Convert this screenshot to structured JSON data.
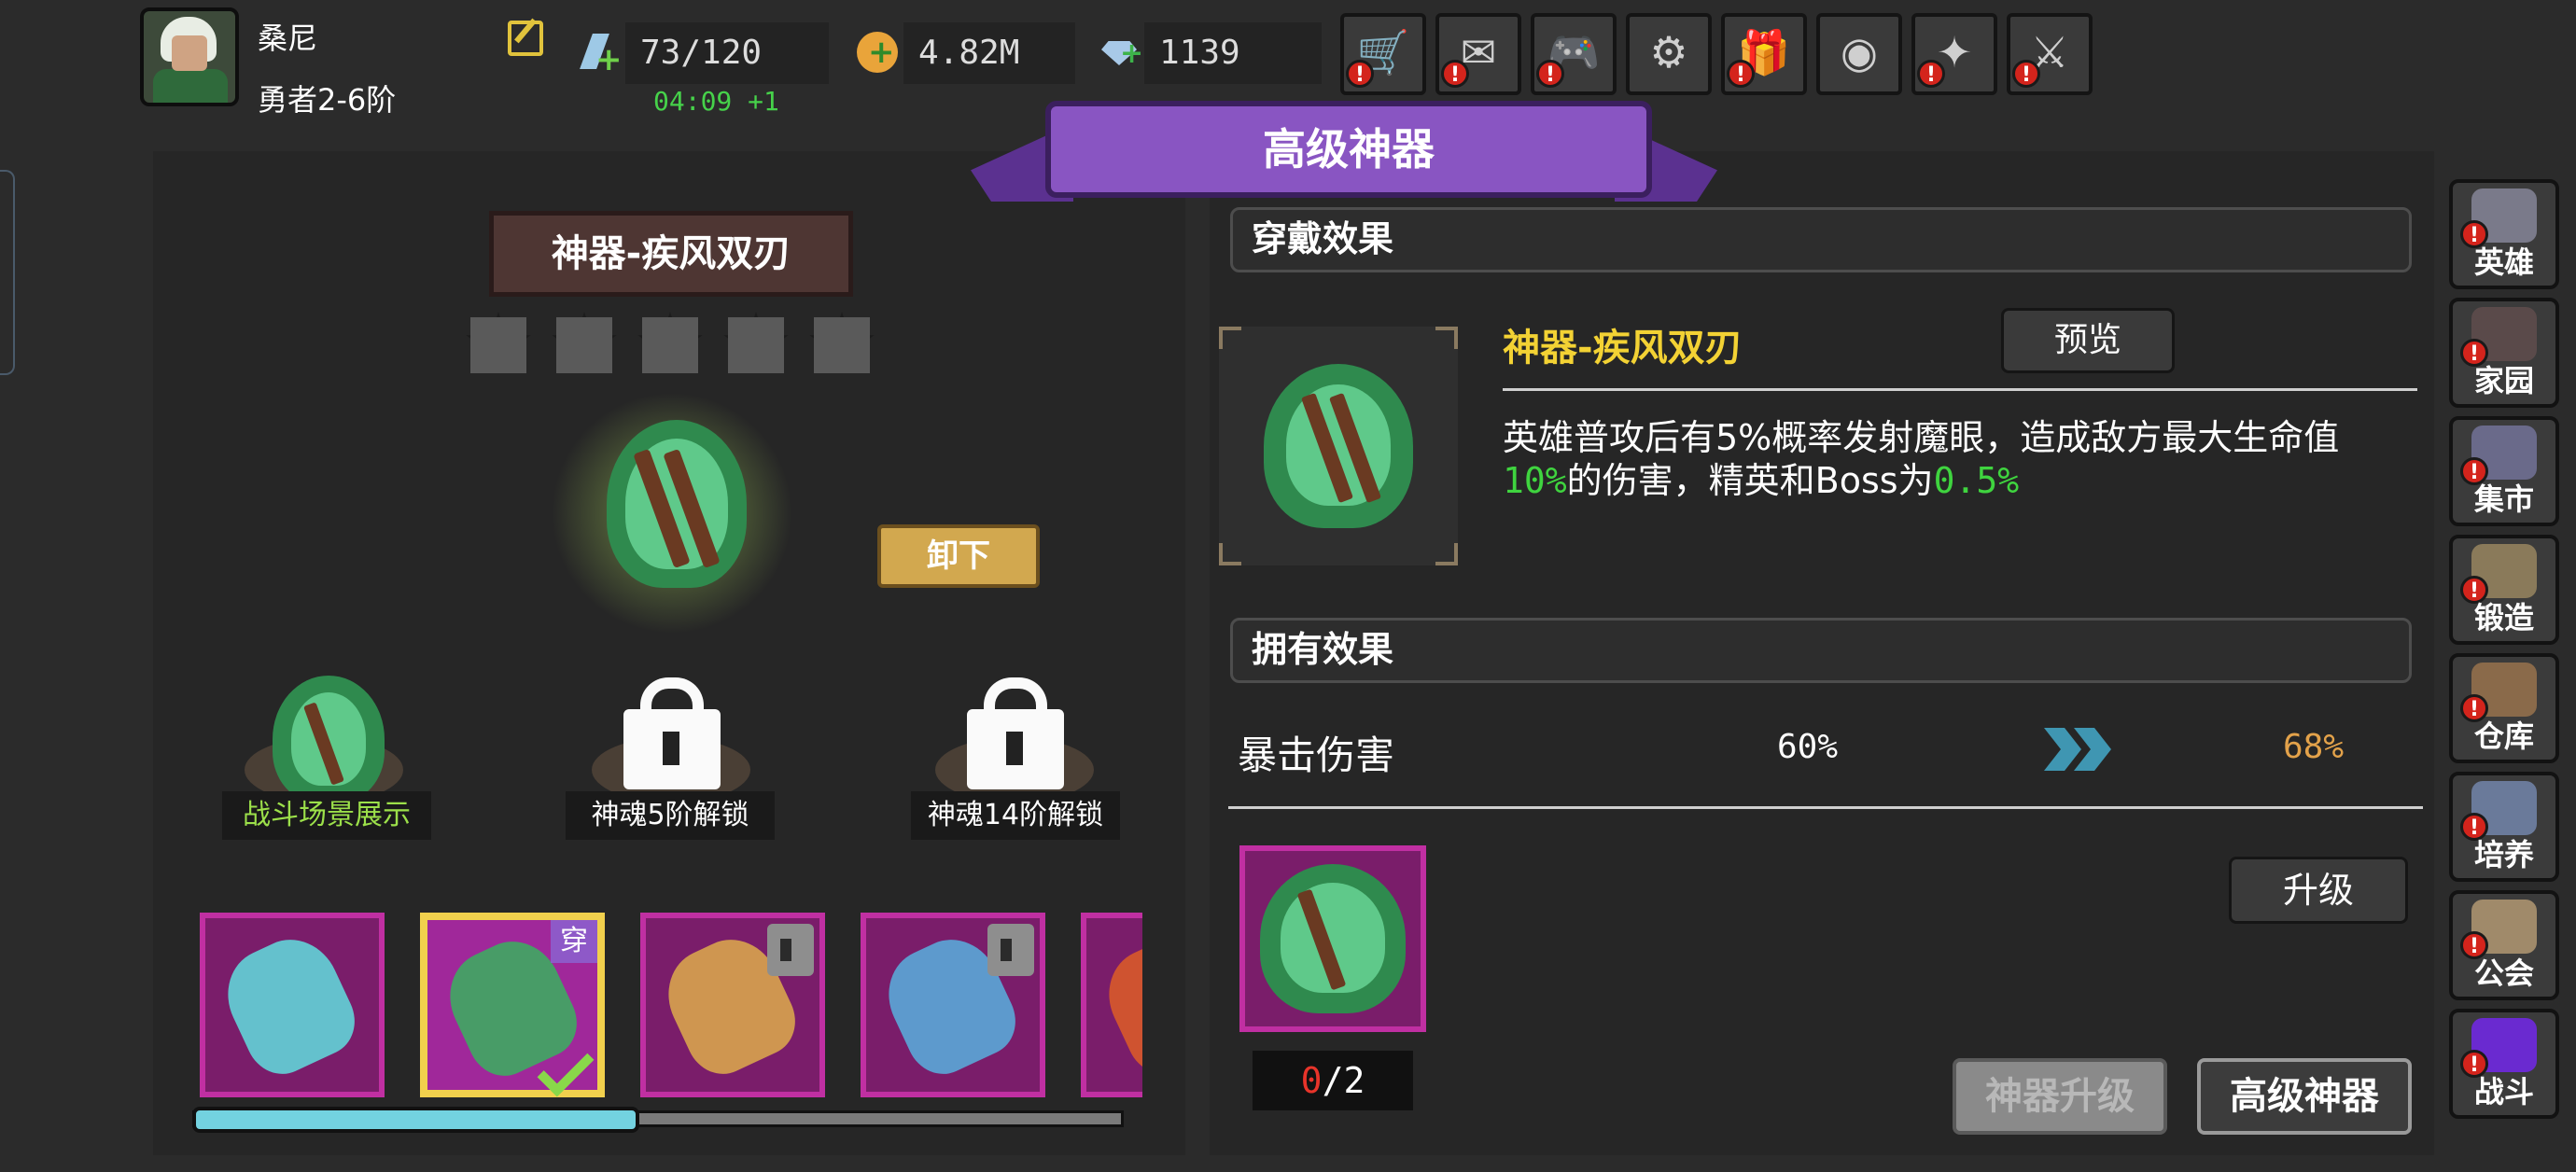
{
  "player": {
    "name": "桑尼",
    "rank": "勇者2-6阶"
  },
  "resources": {
    "energy": "73/120",
    "energy_timer": "04:09 +1",
    "gold": "4.82M",
    "gems": "1139"
  },
  "top_buttons": [
    {
      "icon": "shop-cart-icon",
      "glyph": "🛒",
      "badge": "!"
    },
    {
      "icon": "mail-icon",
      "glyph": "✉",
      "badge": "!"
    },
    {
      "icon": "gamepad-icon",
      "glyph": "🎮",
      "badge": "!"
    },
    {
      "icon": "settings-gear-icon",
      "glyph": "⚙",
      "badge": ""
    },
    {
      "icon": "gift-icon",
      "glyph": "🎁",
      "badge": "!"
    },
    {
      "icon": "color-wheel-icon",
      "glyph": "◉",
      "badge": ""
    },
    {
      "icon": "sparkle-icon",
      "glyph": "✦",
      "badge": "!"
    },
    {
      "icon": "crossed-swords-icon",
      "glyph": "⚔",
      "badge": "!"
    }
  ],
  "banner_title": "高级神器",
  "artifact": {
    "name": "神器-疾风双刃",
    "stars": 5,
    "unequip_label": "卸下",
    "slots": [
      {
        "label": "战斗场景展示",
        "locked": false
      },
      {
        "label": "神魂5阶解锁",
        "locked": true
      },
      {
        "label": "神魂14阶解锁",
        "locked": true
      }
    ],
    "item_row": [
      {
        "name": "crystal-blade",
        "color": "#62d4d8",
        "locked": false,
        "selected": false
      },
      {
        "name": "gale-twin-blades",
        "color": "#3ea862",
        "locked": false,
        "selected": true,
        "wear_tag": "穿"
      },
      {
        "name": "frost-axe",
        "color": "#d8a44e",
        "locked": true,
        "selected": false
      },
      {
        "name": "ice-sword",
        "color": "#5aa8d8",
        "locked": true,
        "selected": false
      },
      {
        "name": "flame-item",
        "color": "#d85a2a",
        "locked": false,
        "selected": false
      }
    ],
    "scroll_fraction": 0.48
  },
  "wear_effect": {
    "header": "穿戴效果",
    "name": "神器-疾风双刃",
    "preview_label": "预览",
    "desc_line1": "英雄普攻后有5%概率发射魔眼，造成敌方最大生命值",
    "desc_pct1": "10%",
    "desc_mid": "的伤害，精英和Boss为",
    "desc_pct2": "0.5%"
  },
  "own_effect": {
    "header": "拥有效果",
    "stat_name": "暴击伤害",
    "current": "60%",
    "next": "68%"
  },
  "upgrade": {
    "have": "0",
    "need": "/2",
    "upgrade_label": "升级",
    "artifact_upgrade_label": "神器升级",
    "advanced_artifact_label": "高级神器"
  },
  "sidebar": [
    {
      "label": "英雄",
      "icon": "helmet-icon",
      "color": "#7a7a8a"
    },
    {
      "label": "家园",
      "icon": "castle-icon",
      "color": "#5a4a4a"
    },
    {
      "label": "集市",
      "icon": "market-icon",
      "color": "#6a6a8a"
    },
    {
      "label": "锻造",
      "icon": "anvil-icon",
      "color": "#8a7a5a"
    },
    {
      "label": "仓库",
      "icon": "warehouse-icon",
      "color": "#8a6a4a"
    },
    {
      "label": "培养",
      "icon": "trophy-icon",
      "color": "#6a7a9a"
    },
    {
      "label": "公会",
      "icon": "guild-icon",
      "color": "#a08a6a"
    },
    {
      "label": "战斗",
      "icon": "portal-icon",
      "color": "#6a2ad0"
    }
  ],
  "colors": {
    "accent_purple": "#8955c2",
    "artifact_name_yellow": "#f3d234",
    "value_green": "#3fd43f",
    "next_value_orange": "#e3a24a",
    "alert_red": "#d4241c"
  }
}
